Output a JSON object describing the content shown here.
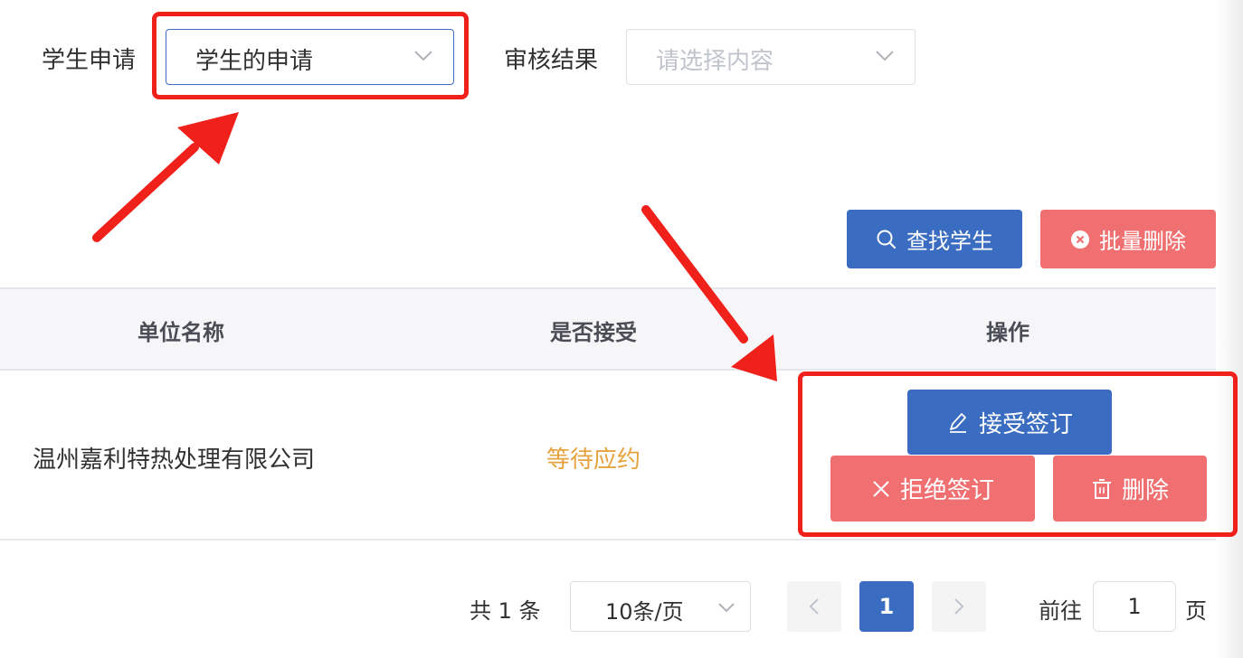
{
  "filters": {
    "student_apply_label": "学生申请",
    "student_apply_value": "学生的申请",
    "review_result_label": "审核结果",
    "review_result_placeholder": "请选择内容"
  },
  "toolbar": {
    "search_label": "查找学生",
    "batch_delete_label": "批量删除"
  },
  "table": {
    "columns": [
      "单位名称",
      "是否接受",
      "操作"
    ],
    "rows": [
      {
        "company": "温州嘉利特热处理有限公司",
        "status": "等待应约",
        "actions": {
          "accept": "接受签订",
          "reject": "拒绝签订",
          "delete": "删除"
        }
      }
    ]
  },
  "pagination": {
    "total_text": "共 1 条",
    "page_size": "10条/页",
    "current_page": "1",
    "goto_prefix": "前往",
    "goto_value": "1",
    "goto_suffix": "页"
  },
  "colors": {
    "primary": "#3a6cc1",
    "danger": "#f07072",
    "warning_text": "#e6a23c",
    "annotation": "#f0201a"
  },
  "icons": [
    "chevron-down-icon",
    "search-icon",
    "circle-close-icon",
    "edit-icon",
    "close-icon",
    "trash-icon",
    "chevron-left-icon",
    "chevron-right-icon",
    "arrow-annotation"
  ]
}
